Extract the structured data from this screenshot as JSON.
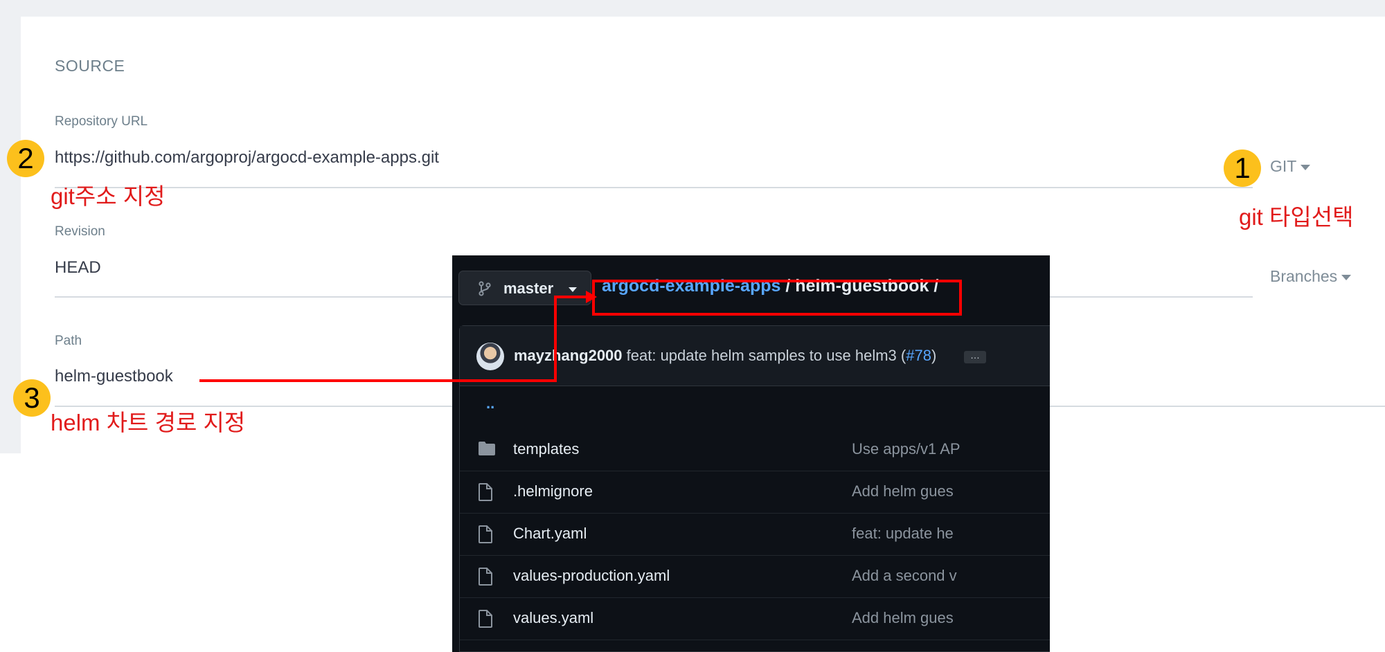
{
  "argocd": {
    "section_title": "SOURCE",
    "repo_label": "Repository URL",
    "repo_value": "https://github.com/argoproj/argocd-example-apps.git",
    "repo_type": "GIT",
    "revision_label": "Revision",
    "revision_value": "HEAD",
    "revision_type": "Branches",
    "path_label": "Path",
    "path_value": "helm-guestbook"
  },
  "annotations": {
    "badge_1": "1",
    "badge_2": "2",
    "badge_3": "3",
    "note_1": "git 타입선택",
    "note_2": "git주소 지정",
    "note_3": "helm 차트 경로 지정",
    "color": "#e11b1b",
    "badge_color": "#fcc01c"
  },
  "github": {
    "branch": "master",
    "breadcrumb_repo": "argocd-example-apps",
    "breadcrumb_sep1": "/",
    "breadcrumb_dir": "helm-guestbook",
    "breadcrumb_sep2": "/",
    "commit_user": "mayzhang2000",
    "commit_message": "feat: update helm samples to use helm3 (",
    "commit_pr": "#78",
    "commit_close": ")",
    "commit_more": "…",
    "parent_dir": "..",
    "files": [
      {
        "name": "templates",
        "type": "folder",
        "message": "Use apps/v1 AP"
      },
      {
        "name": ".helmignore",
        "type": "file",
        "message": "Add helm gues"
      },
      {
        "name": "Chart.yaml",
        "type": "file",
        "message": "feat: update he"
      },
      {
        "name": "values-production.yaml",
        "type": "file",
        "message": "Add a second v"
      },
      {
        "name": "values.yaml",
        "type": "file",
        "message": "Add helm gues"
      }
    ]
  }
}
